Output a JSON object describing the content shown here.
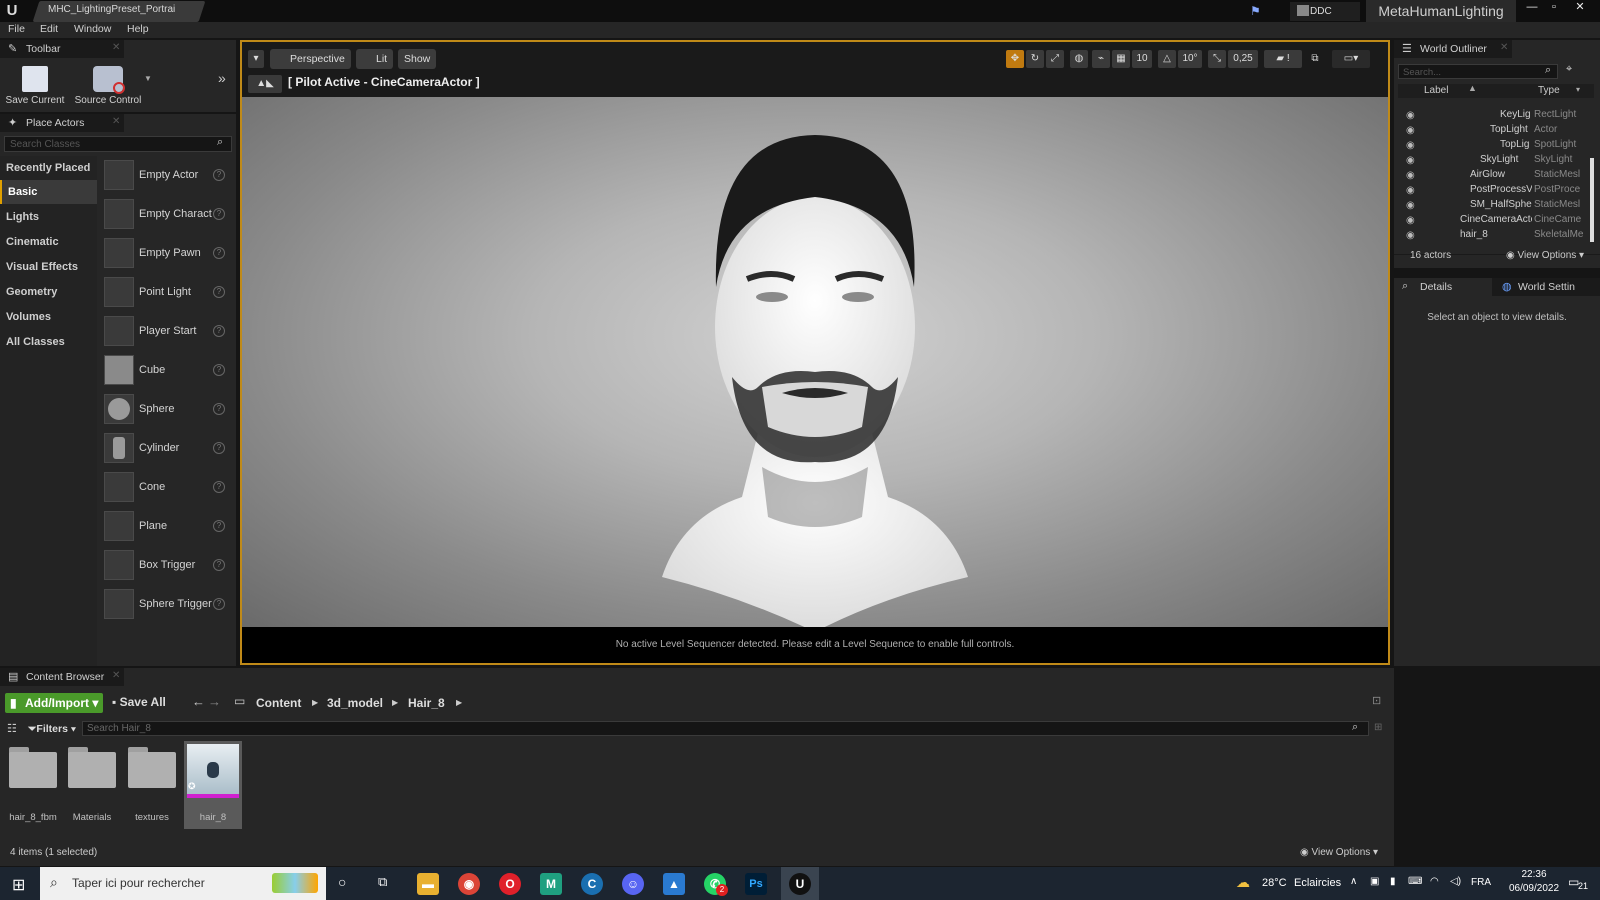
{
  "titlebar": {
    "tab_title": "MHC_LightingPreset_Portrai",
    "ddc_label": "DDC",
    "project_name": "MetaHumanLighting"
  },
  "menu": [
    "File",
    "Edit",
    "Window",
    "Help"
  ],
  "toolbar": {
    "title": "Toolbar",
    "save_current": "Save Current",
    "source_control": "Source Control"
  },
  "place_actors": {
    "title": "Place Actors",
    "search_placeholder": "Search Classes",
    "categories": [
      "Recently Placed",
      "Basic",
      "Lights",
      "Cinematic",
      "Visual Effects",
      "Geometry",
      "Volumes",
      "All Classes"
    ],
    "active_category": "Basic",
    "actors": [
      "Empty Actor",
      "Empty Charact",
      "Empty Pawn",
      "Point Light",
      "Player Start",
      "Cube",
      "Sphere",
      "Cylinder",
      "Cone",
      "Plane",
      "Box Trigger",
      "Sphere Trigger"
    ]
  },
  "viewport": {
    "perspective": "Perspective",
    "lit": "Lit",
    "show": "Show",
    "pilot": "[ Pilot Active - CineCameraActor ]",
    "grid_value": "10",
    "angle_value": "10°",
    "scale_value": "0,25",
    "message": "No active Level Sequencer detected. Please edit a Level Sequence to enable full controls."
  },
  "outliner": {
    "title": "World Outliner",
    "search_placeholder": "Search...",
    "col_label": "Label",
    "col_type": "Type",
    "rows": [
      {
        "name": "KeyLigl",
        "type": "RectLight"
      },
      {
        "name": "TopLight",
        "type": "Actor"
      },
      {
        "name": "TopLigl",
        "type": "SpotLight"
      },
      {
        "name": "SkyLight",
        "type": "SkyLight"
      },
      {
        "name": "AirGlow",
        "type": "StaticMesl"
      },
      {
        "name": "PostProcessV",
        "type": "PostProce"
      },
      {
        "name": "SM_HalfSpher",
        "type": "StaticMesl"
      },
      {
        "name": "CineCameraActo",
        "type": "CineCame"
      },
      {
        "name": "hair_8",
        "type": "SkeletalMe"
      }
    ],
    "actor_count": "16 actors",
    "view_options": "View Options"
  },
  "details": {
    "tab_details": "Details",
    "tab_world": "World Settin",
    "empty_message": "Select an object to view details."
  },
  "content_browser": {
    "title": "Content Browser",
    "add_import": "Add/Import",
    "save_all": "Save All",
    "breadcrumb": [
      "Content",
      "3d_model",
      "Hair_8"
    ],
    "filters": "Filters",
    "search_placeholder": "Search Hair_8",
    "assets": [
      "hair_8_fbm",
      "Materials",
      "textures",
      "hair_8"
    ],
    "item_count": "4 items (1 selected)",
    "view_options": "View Options"
  },
  "taskbar": {
    "search_placeholder": "Taper ici pour rechercher",
    "weather_temp": "28°C",
    "weather_desc": "Eclaircies",
    "lang": "FRA",
    "time": "22:36",
    "date": "06/09/2022",
    "notif_count": "21",
    "whatsapp_badge": "2"
  },
  "colors": {
    "accent": "#c08a18",
    "add_green": "#4a9a2a",
    "panel_bg": "#262626",
    "taskbar": "#1c2530"
  }
}
